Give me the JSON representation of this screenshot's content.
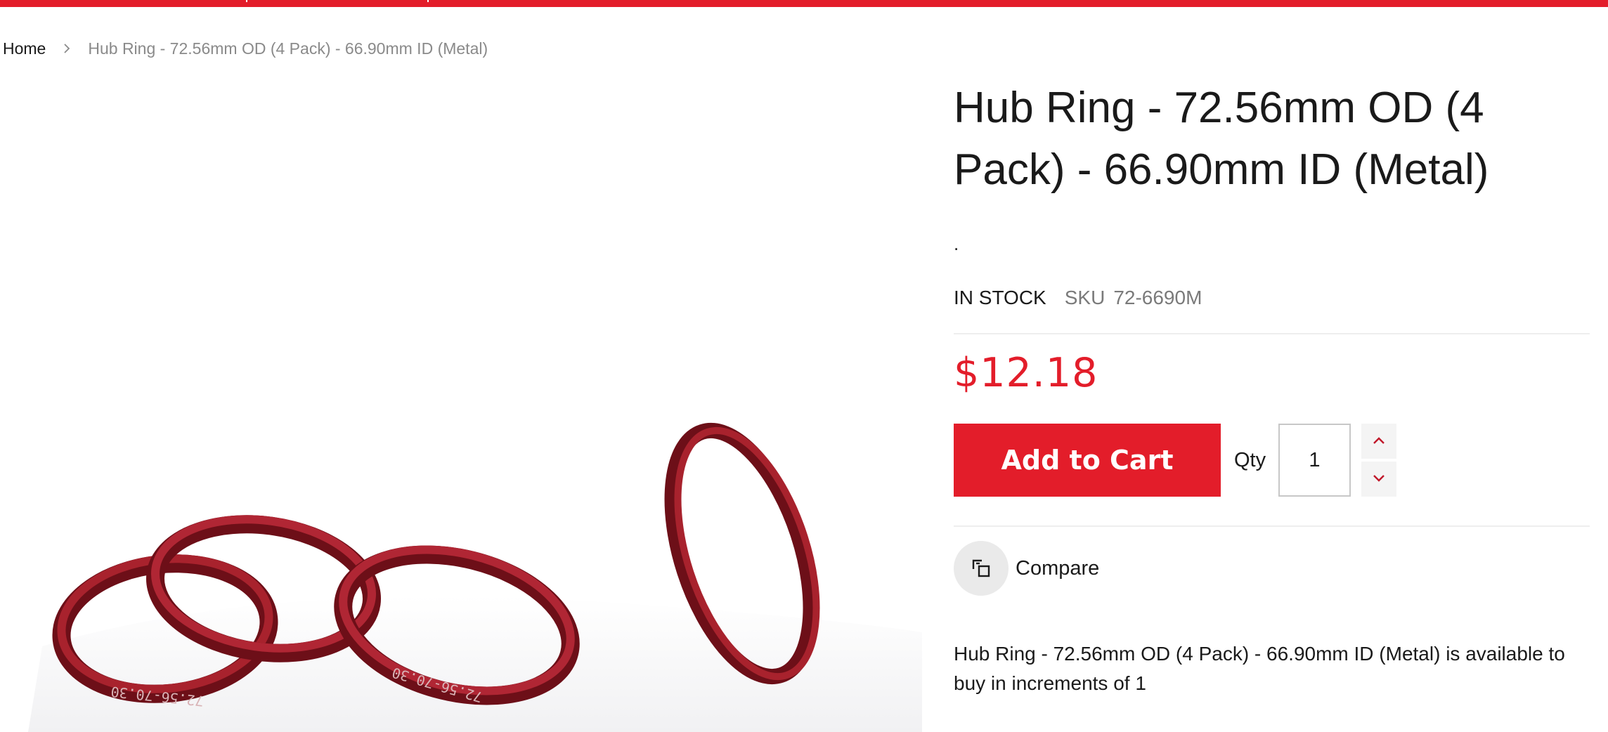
{
  "breadcrumb": {
    "home": "Home",
    "current": "Hub Ring - 72.56mm OD (4 Pack) - 66.90mm ID (Metal)"
  },
  "product": {
    "title": "Hub Ring - 72.56mm OD (4 Pack) - 66.90mm ID (Metal)",
    "brand_placeholder": ".",
    "stock_status": "IN STOCK",
    "sku_label": "SKU",
    "sku": "72-6690M",
    "price": "$12.18",
    "add_to_cart_label": "Add to Cart",
    "qty_label": "Qty",
    "qty_value": "1",
    "compare_label": "Compare",
    "description": "Hub Ring - 72.56mm OD (4 Pack) - 66.90mm ID (Metal) is available to buy in increments of 1",
    "image_ring_engravings": [
      "72.56-70.30",
      "72.56-70.30"
    ]
  },
  "colors": {
    "accent": "#e31d2a",
    "ring": "#8e1520",
    "muted_text": "#8a8a8a"
  },
  "icons": {
    "breadcrumb_separator": "chevron-right-icon",
    "qty_increase": "chevron-up-icon",
    "qty_decrease": "chevron-down-icon",
    "compare": "compare-squares-icon"
  }
}
